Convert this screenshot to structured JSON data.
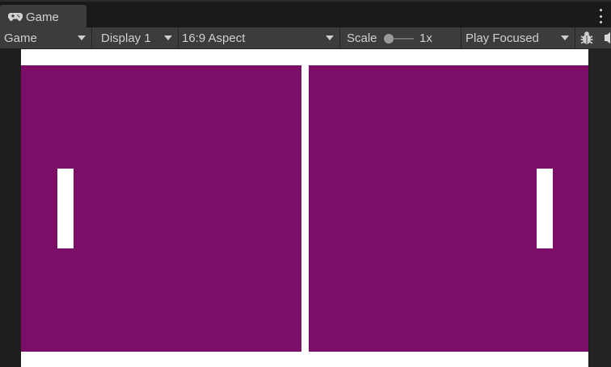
{
  "tab": {
    "title": "Game",
    "icon": "gamepad-icon"
  },
  "toolbar": {
    "view_mode": "Game",
    "display": "Display 1",
    "aspect": "16:9 Aspect",
    "scale_label": "Scale",
    "scale_value": "1x",
    "play_mode": "Play Focused",
    "debug_icon": "bug-icon",
    "audio_icon": "audio-icon"
  },
  "game": {
    "background_color": "#7d0e67",
    "field_color": "#ffffff",
    "paddle_color": "#ffffff"
  }
}
